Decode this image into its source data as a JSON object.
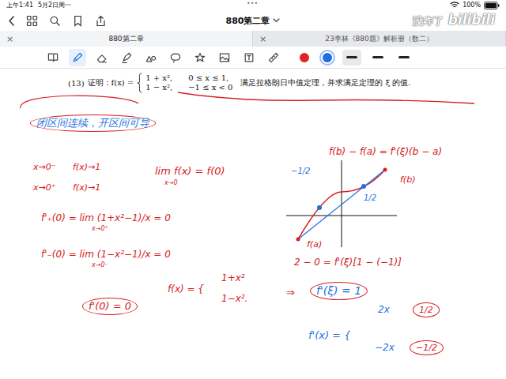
{
  "status_bar": {
    "time": "上午1:41",
    "date": "5月2日周一",
    "dots": "•••",
    "battery": "100%"
  },
  "nav": {
    "title": "880第二章"
  },
  "watermark": {
    "text": "没咋了",
    "logo": "bilibili"
  },
  "tabs": [
    {
      "label": "880第二章",
      "selected": true,
      "close": "×"
    },
    {
      "label": "23李林《880题》解析册（数二）",
      "selected": false,
      "close": "×"
    }
  ],
  "toolbar": {
    "tools": [
      {
        "kind": "book",
        "selected": false
      },
      {
        "kind": "pen",
        "selected": true
      },
      {
        "kind": "eraser",
        "selected": false
      },
      {
        "kind": "highlighter",
        "selected": false
      },
      {
        "kind": "shapes",
        "selected": false
      },
      {
        "kind": "lasso",
        "selected": false
      },
      {
        "kind": "star",
        "selected": false
      },
      {
        "kind": "image",
        "selected": false
      },
      {
        "kind": "text",
        "selected": false
      },
      {
        "kind": "ruler",
        "selected": false
      }
    ],
    "colors": [
      {
        "color": "#e02424",
        "selected": false
      },
      {
        "color": "#1f6fe0",
        "selected": true
      }
    ],
    "widths": [
      {
        "selected": true
      },
      {
        "selected": false
      },
      {
        "selected": false
      }
    ]
  },
  "problem": {
    "number": "(13)",
    "lead": "证明：f(x) =",
    "cases": [
      {
        "expr": "1 + x²,",
        "domain": "0 ≤ x ≤ 1,"
      },
      {
        "expr": "1 − x²,",
        "domain": "−1 ≤ x < 0"
      }
    ],
    "tail": "满足拉格朗日中值定理，并求满足定理的 ξ 的值."
  },
  "notes": [
    {
      "text": "闭区间连续，开区间可导",
      "color": "#1f6fe0",
      "circled": true
    },
    {
      "text": "x→0⁻",
      "color": "#d42020",
      "circled": false
    },
    {
      "text": "f(x)→1",
      "color": "#d42020",
      "circled": false
    },
    {
      "text": "x→0⁺",
      "color": "#d42020",
      "circled": false
    },
    {
      "text": "f(x)→1",
      "color": "#d42020",
      "circled": false
    },
    {
      "text": "lim f(x) = f(0)",
      "color": "#d42020",
      "circled": false
    },
    {
      "text": "x→0",
      "color": "#d42020",
      "circled": false
    },
    {
      "text": "f'₊(0) = lim (1+x²−1)/x = 0",
      "color": "#d42020",
      "circled": false
    },
    {
      "text": "x→0⁺",
      "color": "#d42020",
      "circled": false
    },
    {
      "text": "f'₋(0) = lim (1−x²−1)/x = 0",
      "color": "#d42020",
      "circled": false
    },
    {
      "text": "x→0⁻",
      "color": "#d42020",
      "circled": false
    },
    {
      "text": "f'(0) = 0",
      "color": "#d42020",
      "circled": true
    },
    {
      "text": "f(x) = {",
      "color": "#d42020",
      "circled": false
    },
    {
      "text": "1+x²",
      "color": "#d42020",
      "circled": false
    },
    {
      "text": "1−x².",
      "color": "#d42020",
      "circled": false
    },
    {
      "text": "f(b) − f(a) = f'(ξ)(b − a)",
      "color": "#d42020",
      "circled": false
    },
    {
      "text": "−1/2",
      "color": "#1f6fe0",
      "circled": false
    },
    {
      "text": "1/2",
      "color": "#1f6fe0",
      "circled": false
    },
    {
      "text": "f(b)",
      "color": "#d42020",
      "circled": false
    },
    {
      "text": "f(a)",
      "color": "#d42020",
      "circled": false
    },
    {
      "text": "2 − 0 = f'(ξ)[1 − (−1)]",
      "color": "#d42020",
      "circled": false
    },
    {
      "text": "⇒",
      "color": "#d42020",
      "circled": false
    },
    {
      "text": "f'(ξ) = 1",
      "color": "#1f6fe0",
      "circled": true
    },
    {
      "text": "f'(x) = {",
      "color": "#1f6fe0",
      "circled": false
    },
    {
      "text": "2x",
      "color": "#1f6fe0",
      "circled": false
    },
    {
      "text": "−2x",
      "color": "#1f6fe0",
      "circled": false
    },
    {
      "text": "1/2",
      "color": "#d42020",
      "circled": true
    },
    {
      "text": "−1/2",
      "color": "#d42020",
      "circled": true
    }
  ]
}
